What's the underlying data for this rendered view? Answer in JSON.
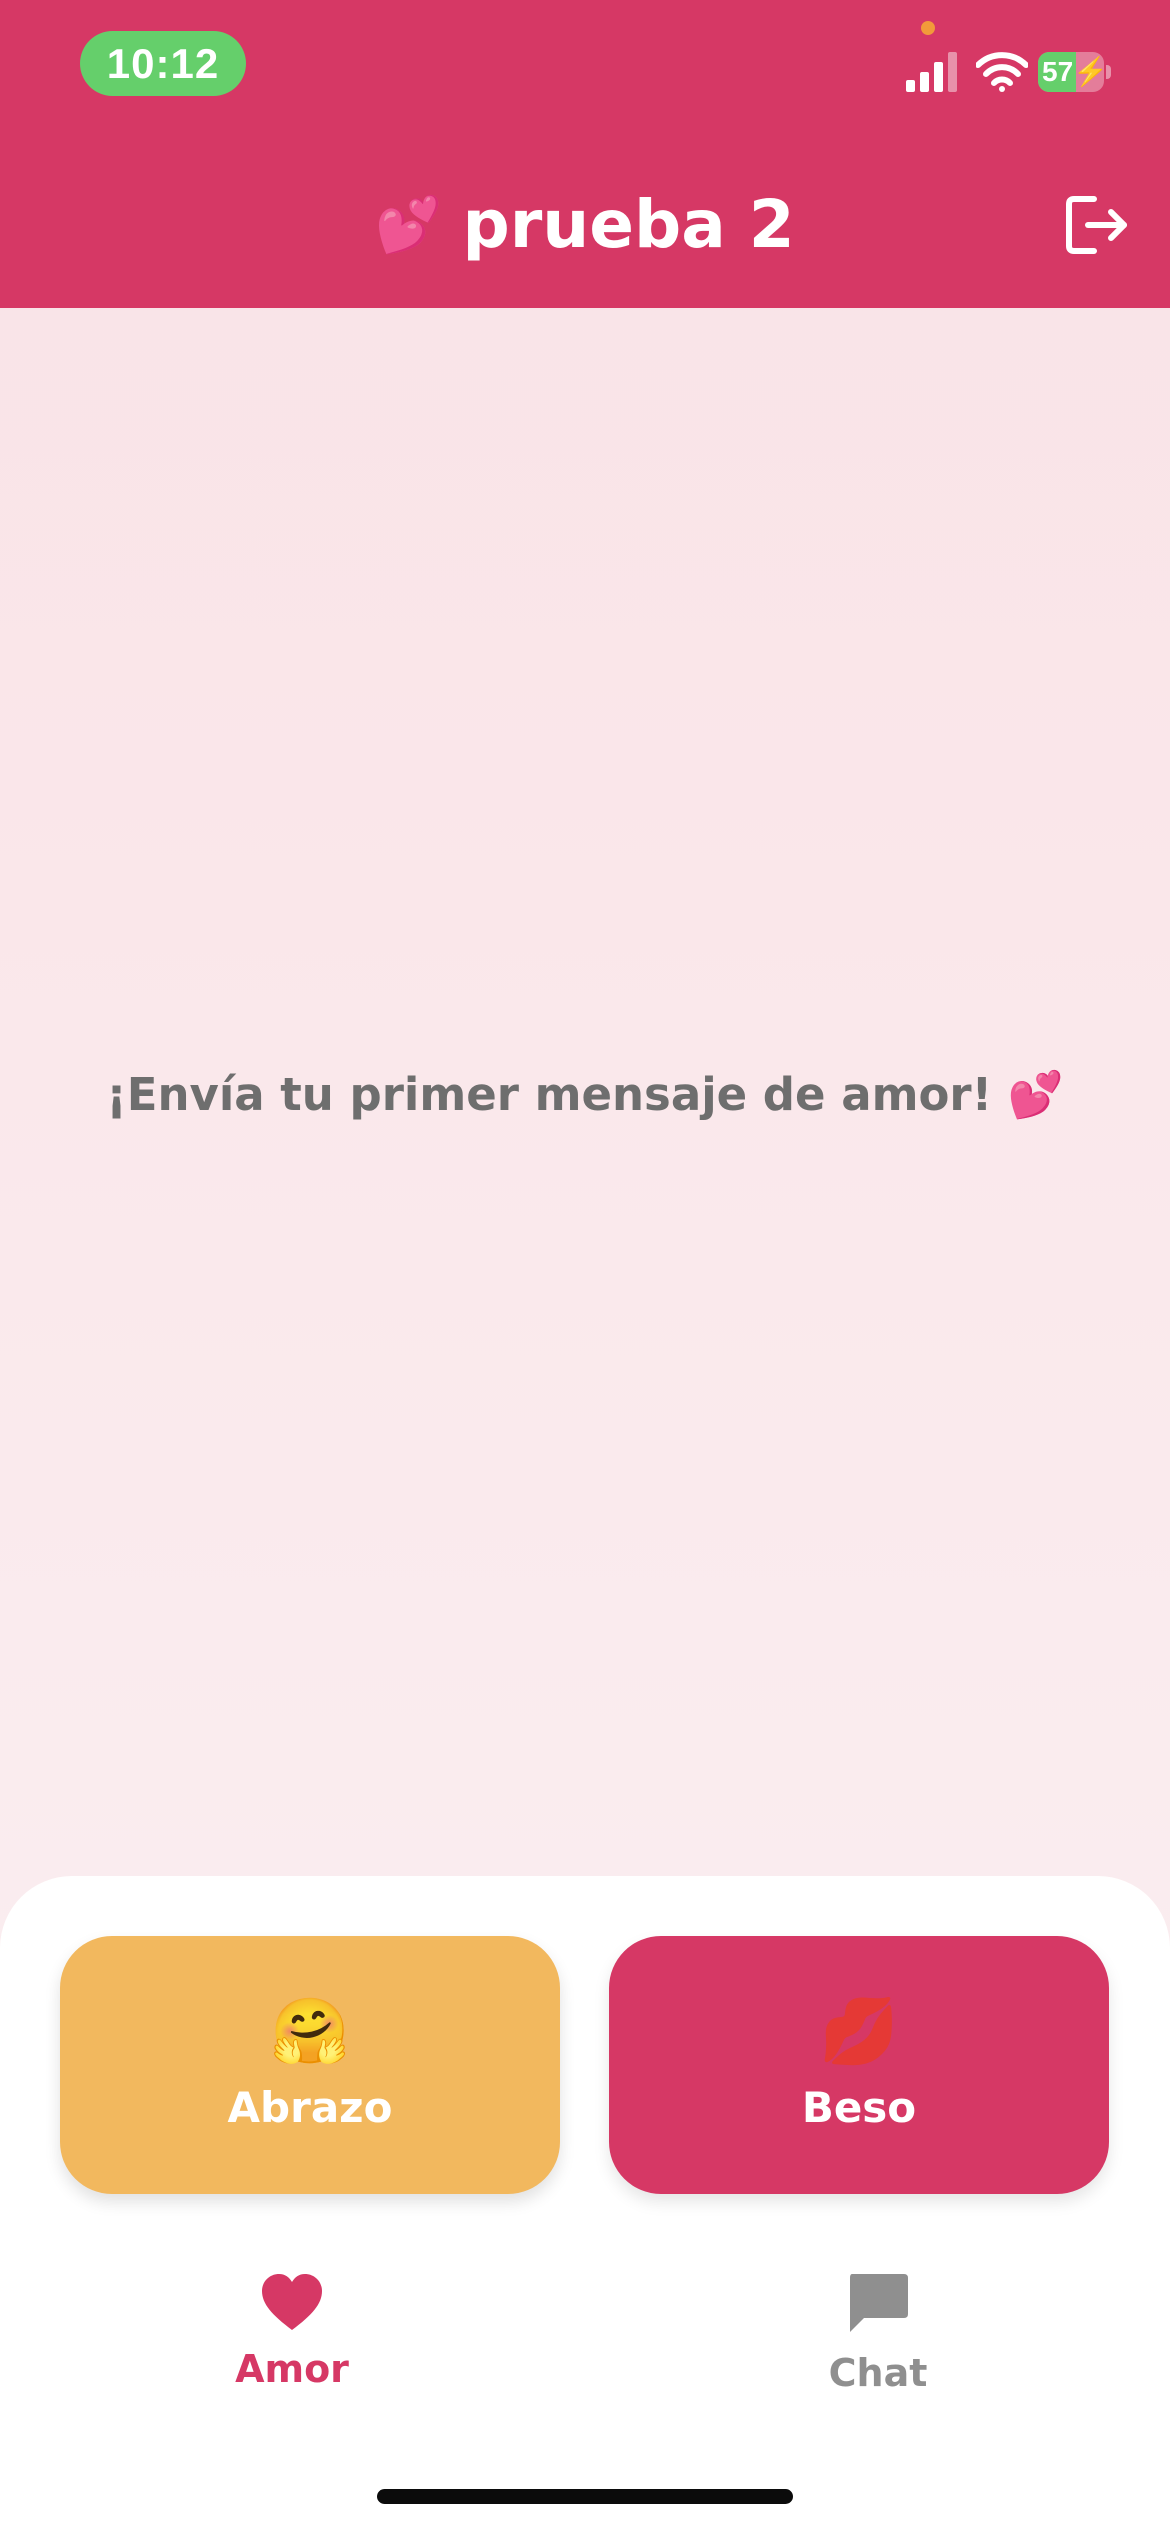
{
  "status_bar": {
    "time": "10:12",
    "battery_percent": 57,
    "battery_label": "57",
    "battery_charging": true,
    "signal_bars": 3,
    "colors": {
      "time_pill": "#65cf6b",
      "privacy_dot": "#f29a3a"
    }
  },
  "header": {
    "title_emoji": "💕",
    "title": "prueba 2",
    "logout_icon": "logout-icon",
    "color": "#d63865"
  },
  "main": {
    "empty_message": "¡Envía tu primer mensaje de amor! 💕"
  },
  "actions": [
    {
      "emoji": "🤗",
      "label": "Abrazo",
      "color": "#f2b85e"
    },
    {
      "emoji": "💋",
      "label": "Beso",
      "color": "#d63865"
    }
  ],
  "tabs": [
    {
      "label": "Amor",
      "icon": "heart-icon",
      "active": true
    },
    {
      "label": "Chat",
      "icon": "chat-bubble-icon",
      "active": false
    }
  ],
  "colors": {
    "accent": "#d63865",
    "hug": "#f2b85e",
    "inactive": "#8f8f8f",
    "empty_text": "#6e6e6e"
  }
}
